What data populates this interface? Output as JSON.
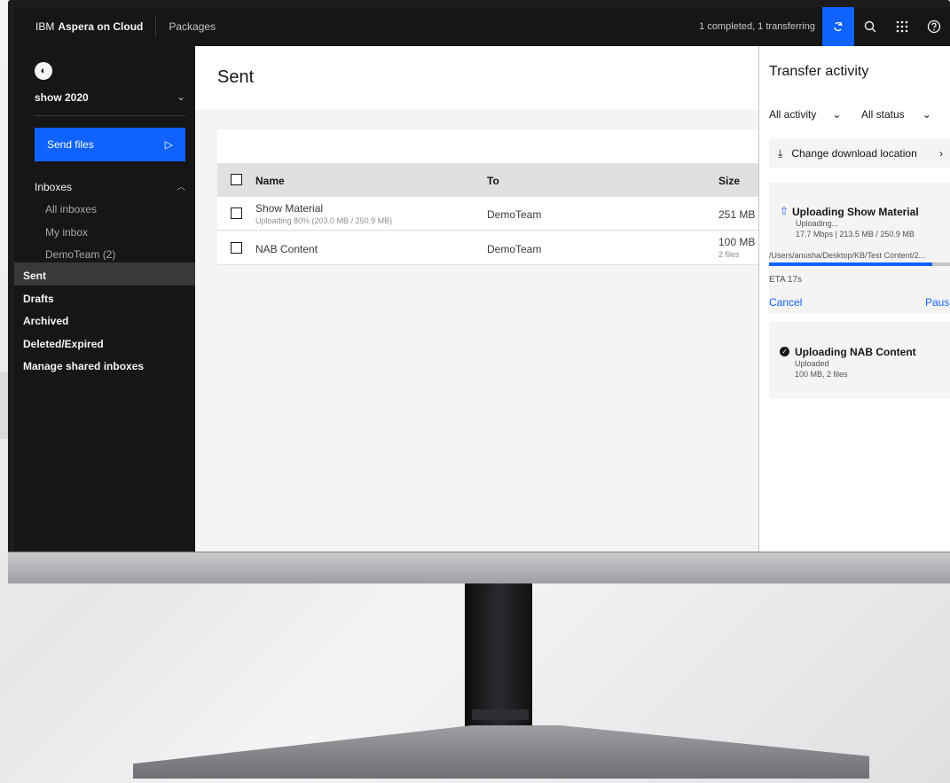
{
  "topbar": {
    "brand_prefix": "IBM",
    "brand_name": "Aspera on Cloud",
    "section": "Packages",
    "transfer_status": "1 completed, 1 transferring",
    "icons": [
      "sync-icon",
      "search-icon",
      "app-switcher-icon",
      "help-icon"
    ]
  },
  "sidebar": {
    "user": "show 2020",
    "send_button": "Send files",
    "inboxes_label": "Inboxes",
    "inbox_items": [
      "All inboxes",
      "My inbox",
      "DemoTeam (2)"
    ],
    "sections": [
      "Sent",
      "Drafts",
      "Archived",
      "Deleted/Expired",
      "Manage shared inboxes"
    ],
    "active": "Sent"
  },
  "main": {
    "title": "Sent",
    "columns": {
      "name": "Name",
      "to": "To",
      "size": "Size"
    },
    "rows": [
      {
        "name": "Show Material",
        "subtitle": "Uploading 80% (203.0 MB / 250.9 MB)",
        "to": "DemoTeam",
        "size": "251 MB",
        "size_sub": ""
      },
      {
        "name": "NAB Content",
        "subtitle": "",
        "to": "DemoTeam",
        "size": "100 MB",
        "size_sub": "2 files"
      }
    ]
  },
  "panel": {
    "title": "Transfer activity",
    "filter_activity": "All activity",
    "filter_status": "All status",
    "change_location": "Change download location",
    "transfers": [
      {
        "title": "Uploading Show Material",
        "status": "Uploading...",
        "rate": "17.7 Mbps | 213.5 MB / 250.9 MB",
        "path": "/Users/anusha/Desktop/KB/Test Content/2...",
        "progress": 0.85,
        "eta": "ETA 17s",
        "cancel": "Cancel",
        "pause": "Pause"
      },
      {
        "title": "Uploading NAB Content",
        "status": "Uploaded",
        "detail": "100 MB, 2 files"
      }
    ]
  },
  "colors": {
    "accent": "#0f62fe",
    "shell": "#161616"
  }
}
